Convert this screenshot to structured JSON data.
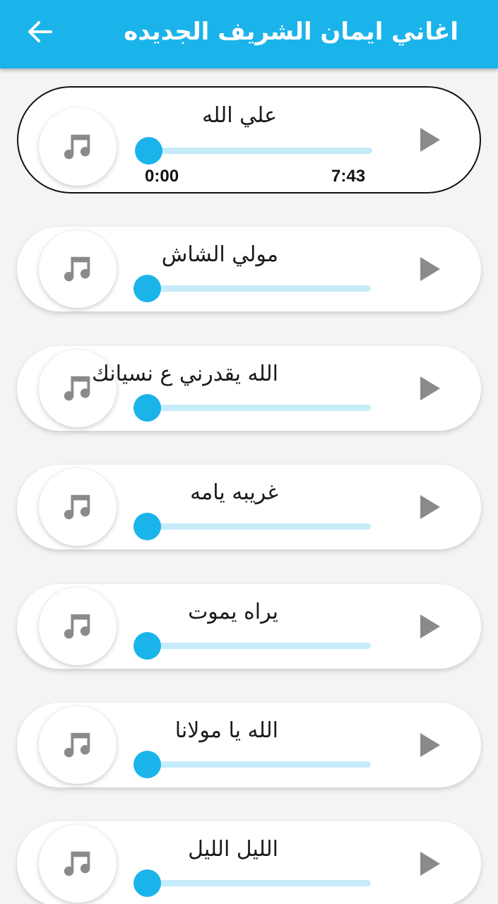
{
  "appbar": {
    "title": "اغاني ايمان الشريف الجديده",
    "back_icon": "arrow-back-icon",
    "color": "#1ab4ea"
  },
  "tracks": [
    {
      "title": "علي الله",
      "active": true,
      "progress": 0,
      "current_time": "0:00",
      "total_time": "7:43"
    },
    {
      "title": "مولي الشاش",
      "active": false,
      "progress": 0
    },
    {
      "title": "الله يقدرني ع نسيانك",
      "active": false,
      "progress": 0
    },
    {
      "title": "غريبه يامه",
      "active": false,
      "progress": 0
    },
    {
      "title": "يراه يموت",
      "active": false,
      "progress": 0
    },
    {
      "title": "الله يا مولانا",
      "active": false,
      "progress": 0
    },
    {
      "title": "الليل الليل",
      "active": false,
      "progress": 0
    }
  ],
  "icons": {
    "cover": "music-note-icon",
    "play": "play-icon"
  },
  "colors": {
    "accent": "#1ab4ea",
    "seek_track": "#c6ecfa",
    "icon_gray": "#8a8a8a",
    "background": "#f4f4f4"
  }
}
